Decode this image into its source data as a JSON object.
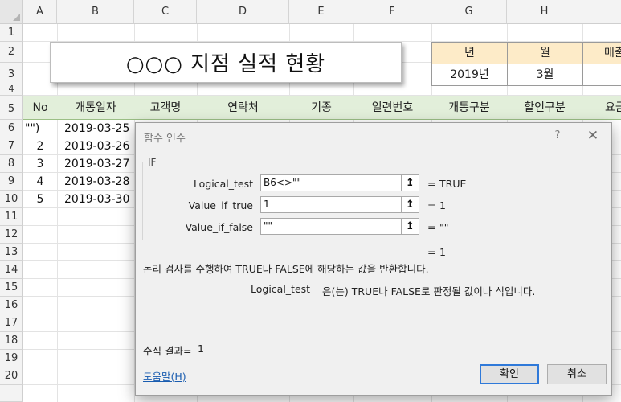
{
  "columns": [
    "A",
    "B",
    "C",
    "D",
    "E",
    "F",
    "G",
    "H"
  ],
  "rows": [
    "1",
    "2",
    "3",
    "4",
    "5",
    "6",
    "7",
    "8",
    "9",
    "10",
    "11",
    "12",
    "13",
    "14",
    "15",
    "16",
    "17",
    "18",
    "19",
    "20"
  ],
  "title_box": "○○○ 지점  실적 현황",
  "year_month_table": {
    "headers": [
      "년",
      "월",
      "매출"
    ],
    "values": [
      "2019년",
      "3월",
      ""
    ]
  },
  "table_headers": [
    "No",
    "개통일자",
    "고객명",
    "연락처",
    "기종",
    "일련번호",
    "개통구분",
    "할인구분",
    "요금"
  ],
  "data_rows": [
    {
      "no": "\"\")",
      "date": "2019-03-25"
    },
    {
      "no": "2",
      "date": "2019-03-26"
    },
    {
      "no": "3",
      "date": "2019-03-27"
    },
    {
      "no": "4",
      "date": "2019-03-28"
    },
    {
      "no": "5",
      "date": "2019-03-30"
    }
  ],
  "dialog": {
    "title": "함수 인수",
    "help_button": "?",
    "close_button": "✕",
    "function_name": "IF",
    "args": [
      {
        "label": "Logical_test",
        "value": "B6<>\"\"",
        "result": "TRUE"
      },
      {
        "label": "Value_if_true",
        "value": "1",
        "result": "1"
      },
      {
        "label": "Value_if_false",
        "value": "\"\"",
        "result": "\"\""
      }
    ],
    "equals": "=",
    "collapse_icon": "↥",
    "overall_result": "1",
    "description": "논리 검사를 수행하여 TRUE나 FALSE에 해당하는 값을 반환합니다.",
    "arg_help_name": "Logical_test",
    "arg_help_text": "은(는) TRUE나 FALSE로 판정될 값이나 식입니다.",
    "formula_result_label": "수식 결과=",
    "formula_result_value": "1",
    "help_link": "도움말(H)",
    "ok_button": "확인",
    "cancel_button": "취소"
  }
}
